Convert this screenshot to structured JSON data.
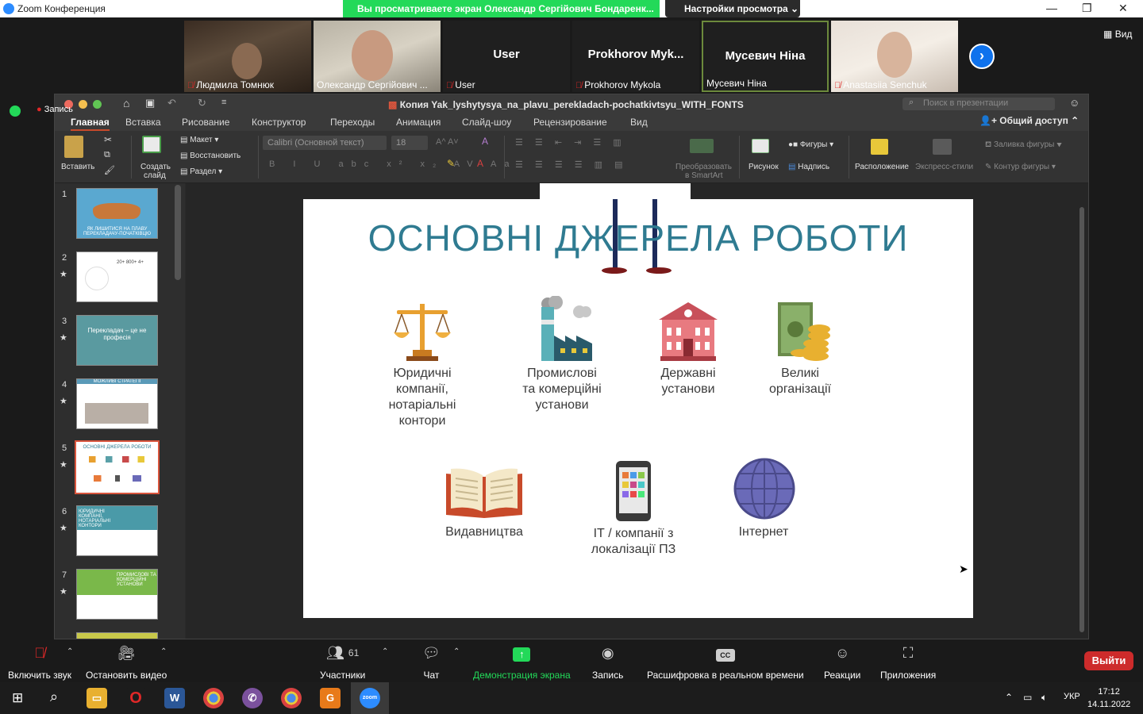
{
  "zoom": {
    "app_title": "Zoom Конференция",
    "share_banner": "Вы просматриваете экран Олександр Сергійович Бондаренк...",
    "view_settings": "Настройки просмотра",
    "view_button": "Вид",
    "recording_label": "Запись",
    "participants_tiles": [
      {
        "name": "Людмила Томнюк",
        "muted": true,
        "video": true
      },
      {
        "name": "Олександр Сергійович ...",
        "muted": false,
        "video": true
      },
      {
        "name": "User",
        "big_name": "User",
        "muted": true,
        "video": false
      },
      {
        "name": "Prokhorov Mykola",
        "big_name": "Prokhorov  Myk...",
        "muted": true,
        "video": false
      },
      {
        "name": "Мусевич Ніна",
        "big_name": "Мусевич Ніна",
        "muted": false,
        "video": false,
        "active": true
      },
      {
        "name": "Anastasiia Senchuk",
        "muted": true,
        "video": true
      }
    ]
  },
  "ppt": {
    "doc_title": "Копия Yak_lyshytysya_na_plavu_perekladach-pochatkivtsyu_WITH_FONTS",
    "search_placeholder": "Поиск в презентации",
    "tabs": [
      "Главная",
      "Вставка",
      "Рисование",
      "Конструктор",
      "Переходы",
      "Анимация",
      "Слайд-шоу",
      "Рецензирование",
      "Вид"
    ],
    "share_access": "Общий доступ",
    "ribbon": {
      "paste": "Вставить",
      "new_slide_1": "Создать",
      "new_slide_2": "слайд",
      "layout": "Макет",
      "reset": "Восстановить",
      "section": "Раздел",
      "font_name": "Calibri (Основной текст)",
      "font_size": "18",
      "smartart_1": "Преобразовать",
      "smartart_2": "в SmartArt",
      "picture": "Рисунок",
      "shapes": "Фигуры",
      "textbox": "Надпись",
      "arrange": "Расположение",
      "quick_styles": "Экспресс-стили",
      "shape_fill": "Заливка фигуры",
      "shape_outline": "Контур фигуры"
    },
    "thumbnails": [
      {
        "num": "1",
        "caption": "ЯК ЛИШИТИСЯ НА ПЛАВУ ПЕРЕКЛАДАЧУ-ПОЧАТКІВЦЮ",
        "star": false
      },
      {
        "num": "2",
        "caption": "20+ 800+ 4+",
        "star": true
      },
      {
        "num": "3",
        "caption": "Перекладач – це не професія",
        "star": true
      },
      {
        "num": "4",
        "caption": "МОЖЛИВІ СТРАТЕГІЇ",
        "star": true
      },
      {
        "num": "5",
        "caption": "ОСНОВНІ ДЖЕРЕЛА РОБОТИ",
        "star": true,
        "selected": true
      },
      {
        "num": "6",
        "caption": "ЮРИДИЧНІ КОМПАНІЇ, НОТАРІАЛЬНІ КОНТОРИ",
        "star": true
      },
      {
        "num": "7",
        "caption": "ПРОМИСЛОВІ ТА КОМЕРЦІЙНІ УСТАНОВИ",
        "star": true
      }
    ],
    "slide": {
      "title": "ОСНОВНІ ДЖЕРЕЛА РОБОТИ",
      "items": [
        {
          "lines": [
            "Юридичні",
            "компанії,",
            "нотаріальні",
            "контори"
          ],
          "icon": "scales-icon"
        },
        {
          "lines": [
            "Промислові",
            "та комерційні",
            "установи"
          ],
          "icon": "factory-icon"
        },
        {
          "lines": [
            "Державні",
            "установи"
          ],
          "icon": "government-building-icon"
        },
        {
          "lines": [
            "Великі",
            "організації"
          ],
          "icon": "money-coins-icon"
        },
        {
          "lines": [
            "Видавництва"
          ],
          "icon": "open-book-icon"
        },
        {
          "lines": [
            "ІТ / компанії з",
            "локалізації ПЗ"
          ],
          "icon": "smartphone-icon"
        },
        {
          "lines": [
            "Інтернет"
          ],
          "icon": "globe-icon"
        }
      ]
    }
  },
  "toolbar": {
    "unmute": "Включить звук",
    "stop_video": "Остановить видео",
    "participants": "Участники",
    "participants_count": "61",
    "chat": "Чат",
    "share_screen": "Демонстрация экрана",
    "record": "Запись",
    "live_transcript": "Расшифровка в реальном времени",
    "reactions": "Реакции",
    "apps": "Приложения",
    "leave": "Выйти"
  },
  "taskbar": {
    "lang": "УКР",
    "time": "17:12",
    "date": "14.11.2022"
  },
  "colors": {
    "zoom_green": "#23d959",
    "slide_title": "#2f7b91",
    "leave_red": "#cd2b2b",
    "selection": "#d9553d"
  }
}
